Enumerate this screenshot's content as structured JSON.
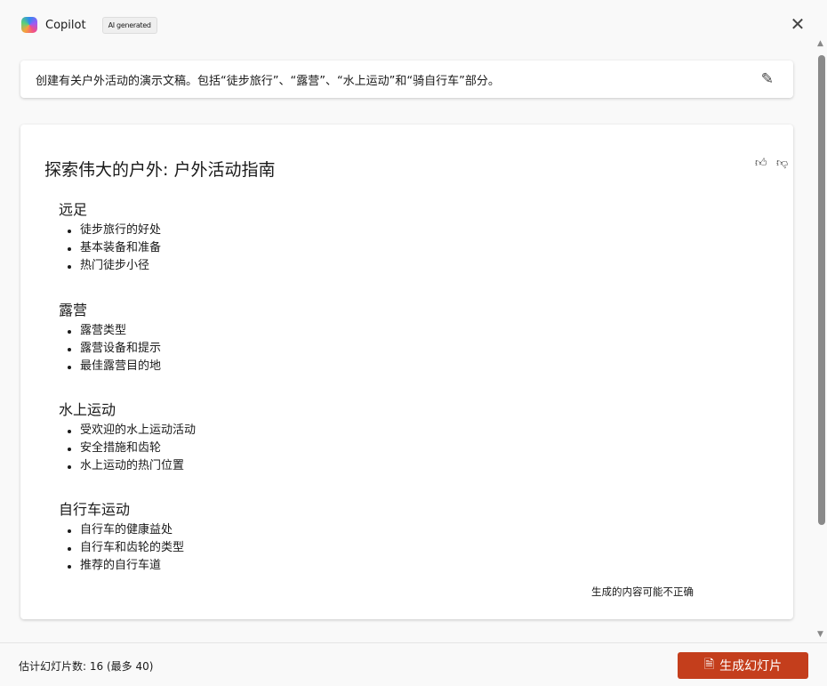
{
  "header": {
    "app_name": "Copilot",
    "badge": "AI generated",
    "close_icon": "close-icon"
  },
  "prompt": {
    "text": "创建有关户外活动的演示文稿。包括“徒步旅行”、“露营”、“水上运动”和“骑自行车”部分。"
  },
  "outline": {
    "title": "探索伟大的户外: 户外活动指南",
    "sections": [
      {
        "heading": "远足",
        "items": [
          "徒步旅行的好处",
          "基本装备和准备",
          "热门徒步小径"
        ]
      },
      {
        "heading": "露营",
        "items": [
          "露营类型",
          "露营设备和提示",
          "最佳露营目的地"
        ]
      },
      {
        "heading": "水上运动",
        "items": [
          "受欢迎的水上运动活动",
          "安全措施和齿轮",
          "水上运动的热门位置"
        ]
      },
      {
        "heading": "自行车运动",
        "items": [
          "自行车的健康益处",
          "自行车和齿轮的类型",
          "推荐的自行车道"
        ]
      }
    ],
    "disclaimer": "生成的内容可能不正确"
  },
  "footer": {
    "slide_count": "估计幻灯片数: 16 (最多 40)",
    "generate_label": "生成幻灯片"
  },
  "colors": {
    "accent": "#c43e1c"
  }
}
